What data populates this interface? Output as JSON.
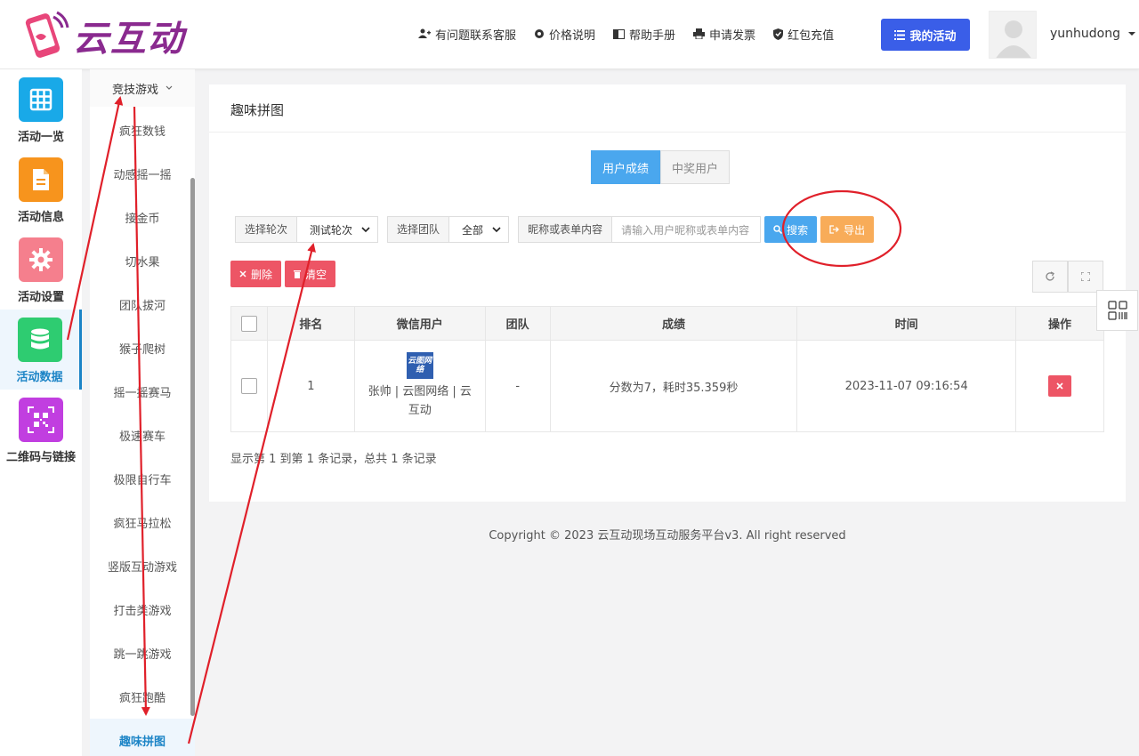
{
  "brand": {
    "name": "云互动"
  },
  "topnav": [
    {
      "label": "有问题联系客服",
      "icon": "user-plus-icon"
    },
    {
      "label": "价格说明",
      "icon": "gear-icon"
    },
    {
      "label": "帮助手册",
      "icon": "book-icon"
    },
    {
      "label": "申请发票",
      "icon": "printer-icon"
    },
    {
      "label": "红包充值",
      "icon": "shield-check-icon"
    }
  ],
  "my_activity_label": "我的活动",
  "username": "yunhudong",
  "rail": [
    {
      "label": "活动一览",
      "color": "#19a9e8",
      "icon": "grid-icon"
    },
    {
      "label": "活动信息",
      "color": "#f7941d",
      "icon": "document-icon"
    },
    {
      "label": "活动设置",
      "color": "#f57f8d",
      "icon": "gear-icon"
    },
    {
      "label": "活动数据",
      "color": "#2ecc71",
      "icon": "database-icon",
      "active": true
    },
    {
      "label": "二维码与链接",
      "color": "#c13ee0",
      "icon": "qrcode-icon"
    }
  ],
  "submenu": {
    "title": "竞技游戏",
    "items": [
      "疯狂数钱",
      "动感摇一摇",
      "接金币",
      "切水果",
      "团队拔河",
      "猴子爬树",
      "摇一摇赛马",
      "极速赛车",
      "极限自行车",
      "疯狂马拉松",
      "竖版互动游戏",
      "打击类游戏",
      "跳一跳游戏",
      "疯狂跑酷",
      "趣味拼图"
    ],
    "active_index": 14
  },
  "panel": {
    "title": "趣味拼图",
    "tabs": [
      "用户成绩",
      "中奖用户"
    ]
  },
  "filters": {
    "round_label": "选择轮次",
    "round_value": "测试轮次",
    "team_label": "选择团队",
    "team_value": "全部",
    "keyword_label": "昵称或表单内容",
    "keyword_placeholder": "请输入用户昵称或表单内容",
    "search_label": "搜索",
    "export_label": "导出"
  },
  "actions": {
    "delete_label": "删除",
    "clear_label": "清空"
  },
  "table": {
    "headers": [
      "排名",
      "微信用户",
      "团队",
      "成绩",
      "时间",
      "操作"
    ],
    "rows": [
      {
        "rank": "1",
        "avatar_text": "云图网络",
        "user": "张帅 | 云图网络 | 云互动",
        "team": "-",
        "score": "分数为7，耗时35.359秒",
        "time": "2023-11-07 09:16:54"
      }
    ]
  },
  "summary": "显示第 1 到第 1 条记录，总共 1 条记录",
  "copyright": "Copyright © 2023 云互动现场互动服务平台v3. All right reserved",
  "colors": {
    "primary": "#3a5ee8",
    "info": "#4aa7ee",
    "warning": "#f8ac59",
    "danger": "#ed5565",
    "annotation": "#e0202a"
  }
}
